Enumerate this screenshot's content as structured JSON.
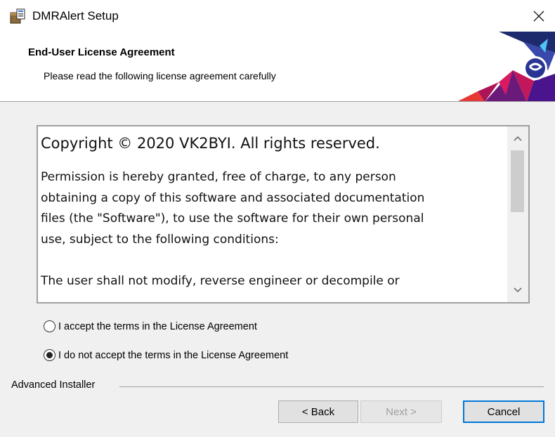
{
  "window": {
    "title": "DMRAlert Setup",
    "close_glyph": "✕",
    "icon": "installer-box-icon"
  },
  "header": {
    "title": "End-User License Agreement",
    "subtitle": "Please read the following license agreement carefully",
    "banner_colors": [
      "#1d2a6b",
      "#6a1b7a",
      "#c2185b",
      "#e53935",
      "#4fc3f7"
    ]
  },
  "license": {
    "title": "Copyright © 2020 VK2BYI.  All rights reserved.",
    "lines": [
      "Permission is hereby granted, free of charge, to any person",
      "obtaining a copy of this software and associated documentation",
      "files (the \"Software\"), to use the software for their own personal",
      "use, subject to the following conditions:",
      "",
      "The user shall not modify, reverse engineer or decompile or"
    ],
    "scroll_up_glyph": "˄",
    "scroll_down_glyph": "˅"
  },
  "options": {
    "accept_label": "I accept the terms in the License Agreement",
    "decline_label": "I do not accept the terms in the License Agreement",
    "selected": "decline"
  },
  "footer": {
    "installer_label": "Advanced Installer",
    "back_label": "< Back",
    "next_label": "Next >",
    "cancel_label": "Cancel"
  }
}
